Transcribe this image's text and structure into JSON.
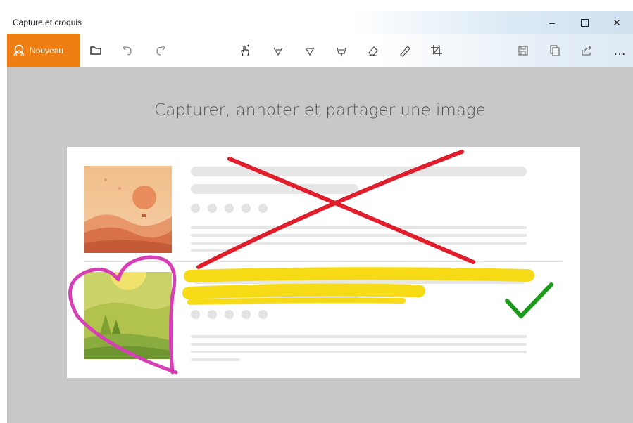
{
  "window": {
    "title": "Capture et croquis",
    "controls": {
      "minimize": "–",
      "maximize": "☐",
      "close": "✕"
    }
  },
  "toolbar": {
    "new_label": "Nouveau",
    "more_label": "…",
    "icons": [
      "new-snip-icon",
      "open-folder-icon",
      "undo-icon",
      "redo-icon",
      "touch-writing-icon",
      "ballpoint-pen-icon",
      "pencil-icon",
      "highlighter-icon",
      "eraser-icon",
      "ruler-icon",
      "crop-icon",
      "save-icon",
      "copy-icon",
      "share-icon",
      "more-icon"
    ],
    "accent": "#f07f13"
  },
  "canvas": {
    "heading": "Capturer, annoter et partager une image",
    "annotation_colors": {
      "cross": "#e01e2c",
      "heart": "#d63fb6",
      "highlight": "#f5d90a",
      "check": "#1a9b1a"
    }
  }
}
